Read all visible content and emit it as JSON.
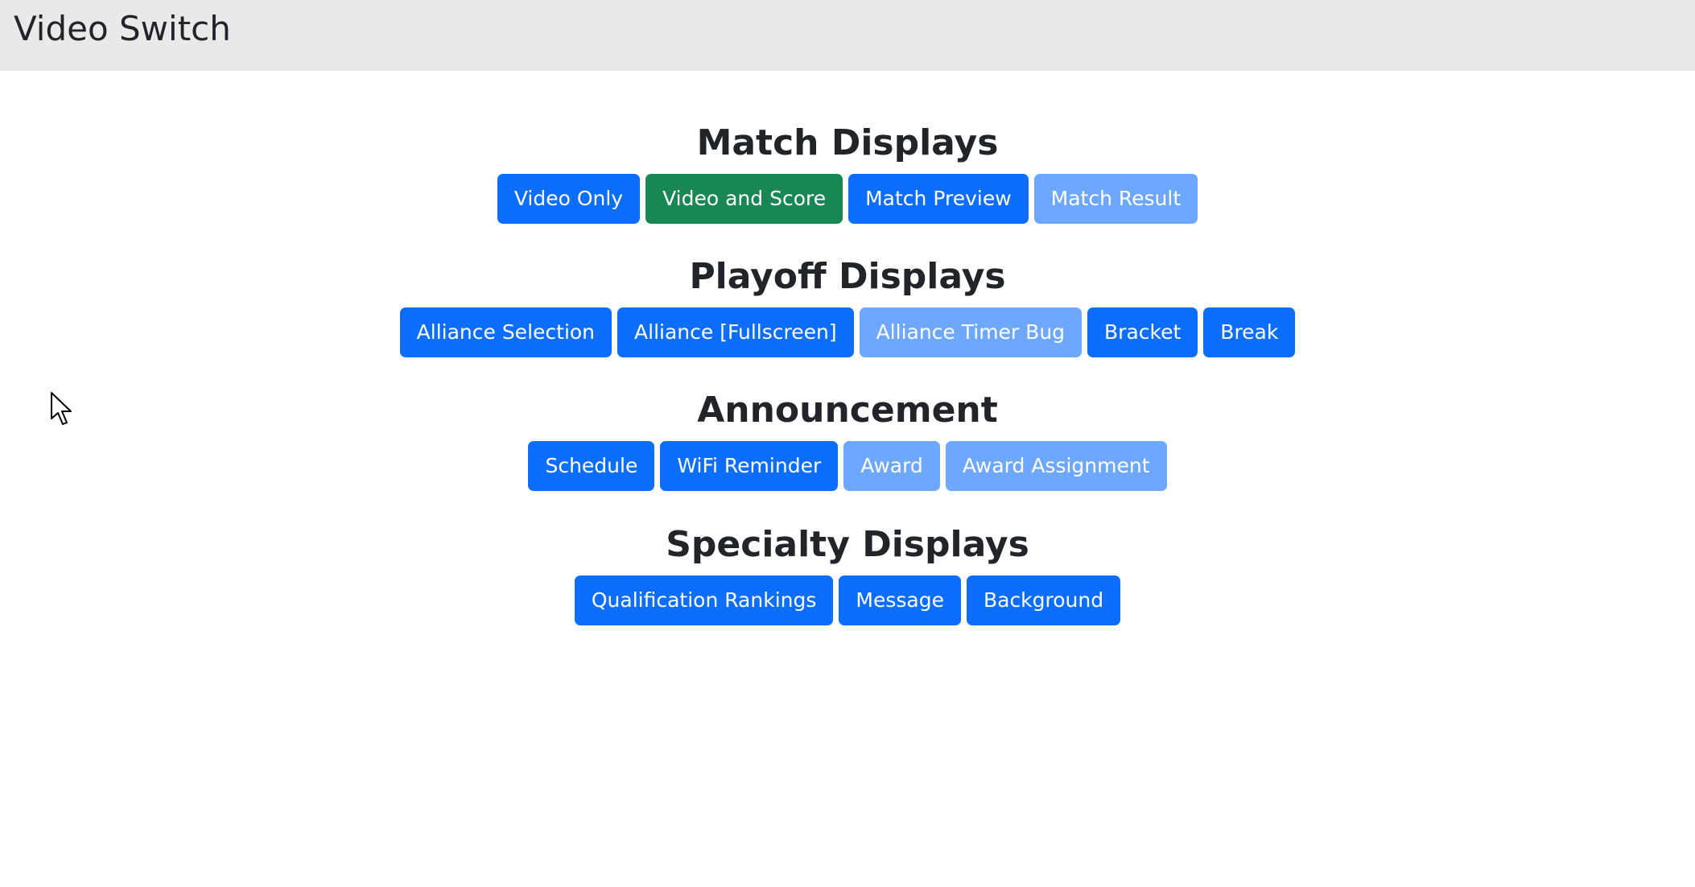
{
  "header": {
    "title": "Video Switch"
  },
  "sections": [
    {
      "title": "Match Displays",
      "buttons": [
        {
          "label": "Video Only",
          "state": "normal"
        },
        {
          "label": "Video and Score",
          "state": "active"
        },
        {
          "label": "Match Preview",
          "state": "normal"
        },
        {
          "label": "Match Result",
          "state": "disabled"
        }
      ]
    },
    {
      "title": "Playoff Displays",
      "buttons": [
        {
          "label": "Alliance Selection",
          "state": "normal"
        },
        {
          "label": "Alliance [Fullscreen]",
          "state": "normal"
        },
        {
          "label": "Alliance Timer Bug",
          "state": "disabled"
        },
        {
          "label": "Bracket",
          "state": "normal"
        },
        {
          "label": "Break",
          "state": "normal"
        }
      ]
    },
    {
      "title": "Announcement",
      "buttons": [
        {
          "label": "Schedule",
          "state": "normal"
        },
        {
          "label": "WiFi Reminder",
          "state": "normal"
        },
        {
          "label": "Award",
          "state": "disabled"
        },
        {
          "label": "Award Assignment",
          "state": "disabled"
        }
      ]
    },
    {
      "title": "Specialty Displays",
      "buttons": [
        {
          "label": "Qualification Rankings",
          "state": "normal"
        },
        {
          "label": "Message",
          "state": "normal"
        },
        {
          "label": "Background",
          "state": "normal"
        }
      ]
    }
  ],
  "colors": {
    "primary": "#0d6efd",
    "active": "#198754",
    "disabled": "#6ea8fe",
    "header_bg": "#e9e9e9"
  },
  "icons": {
    "cursor": "mouse-pointer-icon"
  }
}
